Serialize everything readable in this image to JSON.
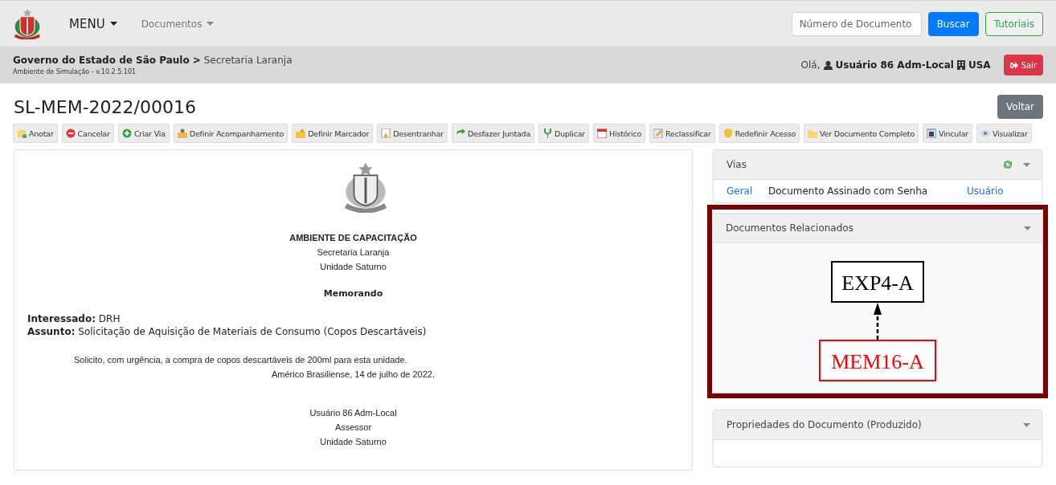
{
  "navbar": {
    "menu": "MENU",
    "documents": "Documentos",
    "search": {
      "placeholder": "Número de Documento"
    },
    "search_button": "Buscar",
    "tutorials_button": "Tutoriais"
  },
  "breadcrumb": {
    "org": "Governo do Estado de São Paulo",
    "separator": ">",
    "unit": "Secretaria Laranja",
    "environment": "Ambiente de Simulação - v.10.2.5.101",
    "greeting": "Olá,",
    "user": "Usuário 86 Adm-Local",
    "location": "USA",
    "logout": "Sair"
  },
  "title": "SL-MEM-2022/00016",
  "back_button": "Voltar",
  "actions": [
    "Anotar",
    "Cancelar",
    "Criar Via",
    "Definir Acompanhamento",
    "Definir Marcador",
    "Desentranhar",
    "Desfazer Juntada",
    "Duplicar",
    "Histórico",
    "Reclassificar",
    "Redefinir Acesso",
    "Ver Documento Completo",
    "Vincular",
    "Visualizar"
  ],
  "document": {
    "heading": "AMBIENTE DE CAPACITAÇÃO",
    "lines": [
      "Secretaria Laranja",
      "Unidade Saturno"
    ],
    "type": "Memorando",
    "fields": [
      {
        "label": "Interessado:",
        "value": "DRH"
      },
      {
        "label": "Assunto:",
        "value": "Solicitação de Aquisição de Materiais de Consumo (Copos Descartáveis)"
      }
    ],
    "body": "Solicito, com urgência, a compra de copos descartáveis de 200ml para esta unidade.",
    "place_date": "Américo Brasiliense, 14 de julho de 2022.",
    "signature": [
      "Usuário 86 Adm-Local",
      "Assessor",
      "Unidade Saturno"
    ]
  },
  "vias": {
    "title": "Vias",
    "row": {
      "via": "Geral",
      "status": "Documento Assinado com Senha",
      "signer": "Usuário"
    }
  },
  "related": {
    "title": "Documentos Relacionados",
    "highlighted": true,
    "nodes": [
      {
        "label": "EXP4-A",
        "color": "#000000"
      },
      {
        "label": "MEM16-A",
        "color": "#ff0000"
      }
    ]
  },
  "properties": {
    "title": "Propriedades do Documento (Produzido)"
  }
}
